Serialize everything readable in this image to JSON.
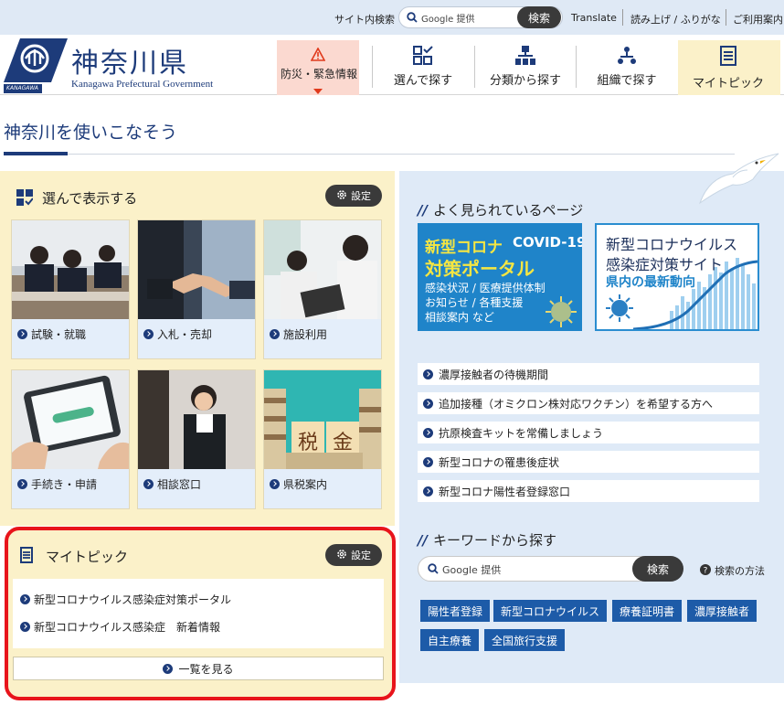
{
  "topbar": {
    "site_search_label": "サイト内検索",
    "google_label": "Google 提供",
    "search_button": "検索",
    "translate": "Translate",
    "read_aloud": "読み上げ / ふりがな",
    "guide": "ご利用案内"
  },
  "header": {
    "logo_small": "KANAGAWA",
    "site_name": "神奈川県",
    "site_name_en": "Kanagawa Prefectural Government",
    "nav": {
      "bousai": "防災・緊急情報",
      "select": "選んで探す",
      "category": "分類から探す",
      "org": "組織で探す",
      "mytopic": "マイトピック"
    }
  },
  "page_title": "神奈川を使いこなそう",
  "select_panel": {
    "title": "選んで表示する",
    "settings": "設定",
    "tiles": [
      {
        "label": "試験・就職"
      },
      {
        "label": "入札・売却"
      },
      {
        "label": "施設利用"
      },
      {
        "label": "手続き・申請"
      },
      {
        "label": "相談窓口"
      },
      {
        "label": "県税案内"
      }
    ],
    "tax_chars": [
      "税",
      "金"
    ]
  },
  "mytopic_panel": {
    "title": "マイトピック",
    "settings": "設定",
    "items": [
      "新型コロナウイルス感染症対策ポータル",
      "新型コロナウイルス感染症　新着情報"
    ],
    "more": "一覧を見る"
  },
  "popular": {
    "title": "よく見られているページ",
    "banner1": {
      "l1a": "新型コロナ",
      "l1b": "COVID-19",
      "l2": "対策ポータル",
      "l3": "感染状況 / 医療提供体制",
      "l4": "お知らせ / 各種支援",
      "l5": "相談案内 など"
    },
    "banner2": {
      "l1": "新型コロナウイルス",
      "l2": "感染症対策サイト",
      "l3": "県内の最新動向"
    },
    "links": [
      "濃厚接触者の待機期間",
      "追加接種（オミクロン株対応ワクチン）を希望する方へ",
      "抗原検査キットを常備しましょう",
      "新型コロナの罹患後症状",
      "新型コロナ陽性者登録窓口"
    ]
  },
  "keyword": {
    "title": "キーワードから探す",
    "google_label": "Google 提供",
    "search_button": "検索",
    "help": "検索の方法",
    "tags": [
      "陽性者登録",
      "新型コロナウイルス",
      "療養証明書",
      "濃厚接触者",
      "自主療養",
      "全国旅行支援"
    ]
  },
  "colors": {
    "navy": "#1d3b7a",
    "panel_yellow": "#fbf1c9",
    "panel_blue": "#dfeaf7",
    "highlight_red": "#e8141b",
    "tag_blue": "#1d5ba8"
  }
}
